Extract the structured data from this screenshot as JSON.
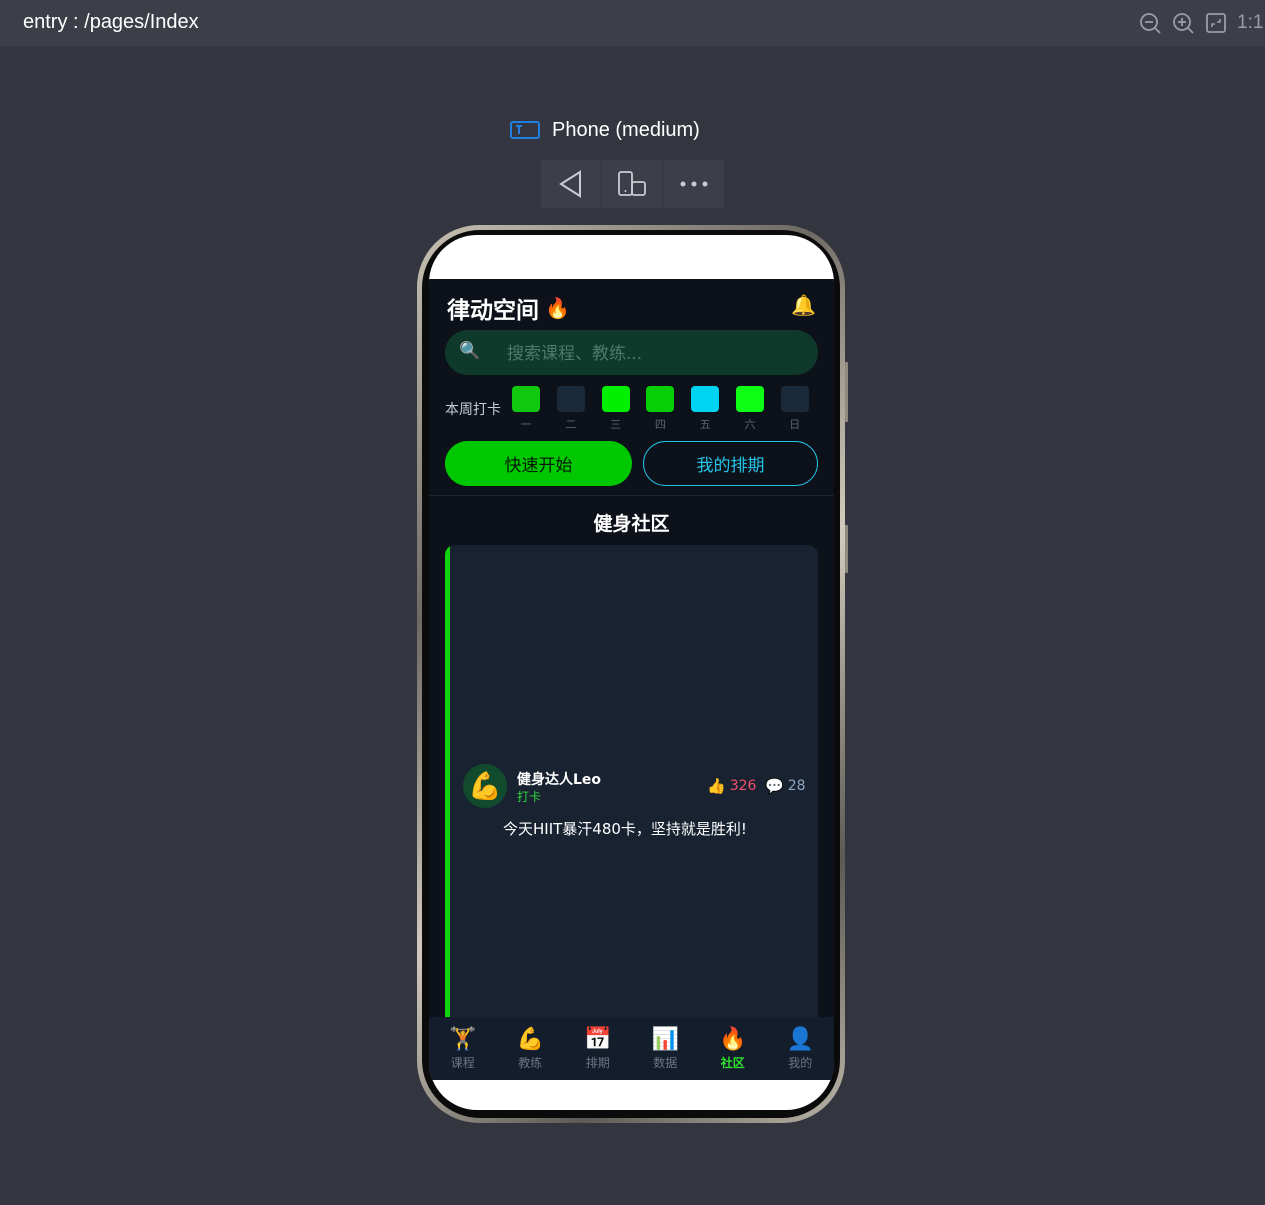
{
  "header": {
    "title": "entry : /pages/Index",
    "ratio_label": "1:1"
  },
  "device": {
    "label": "Phone (medium)"
  },
  "app": {
    "title": "律动空间",
    "title_emoji": "🔥",
    "bell_icon": "🔔",
    "search": {
      "icon": "🔍",
      "placeholder": "搜索课程、教练..."
    },
    "week": {
      "label": "本周打卡",
      "days": [
        {
          "label": "一",
          "color": "#0fc80f"
        },
        {
          "label": "二",
          "color": "#1b2a3a"
        },
        {
          "label": "三",
          "color": "#00f000"
        },
        {
          "label": "四",
          "color": "#06cf06"
        },
        {
          "label": "五",
          "color": "#00d4f2"
        },
        {
          "label": "六",
          "color": "#0dff16"
        },
        {
          "label": "日",
          "color": "#1b2a3a"
        }
      ]
    },
    "buttons": {
      "quick_start": "快速开始",
      "my_schedule": "我的排期"
    },
    "community": {
      "title": "健身社区",
      "post": {
        "avatar": "💪",
        "author": "健身达人Leo",
        "tag": "打卡",
        "like_icon": "👍",
        "likes": "326",
        "comment_icon": "💬",
        "comments": "28",
        "text": "今天HIIT暴汗480卡，坚持就是胜利!"
      }
    },
    "nav": [
      {
        "icon": "🏋️",
        "label": "课程",
        "active": false
      },
      {
        "icon": "💪",
        "label": "教练",
        "active": false
      },
      {
        "icon": "📅",
        "label": "排期",
        "active": false
      },
      {
        "icon": "📊",
        "label": "数据",
        "active": false
      },
      {
        "icon": "🔥",
        "label": "社区",
        "active": true
      },
      {
        "icon": "👤",
        "label": "我的",
        "active": false
      }
    ]
  },
  "colors": {
    "accent_green": "#00c800",
    "accent_cyan": "#22c4e8",
    "like_red": "#f34e6c",
    "app_bg": "#0c111a"
  }
}
